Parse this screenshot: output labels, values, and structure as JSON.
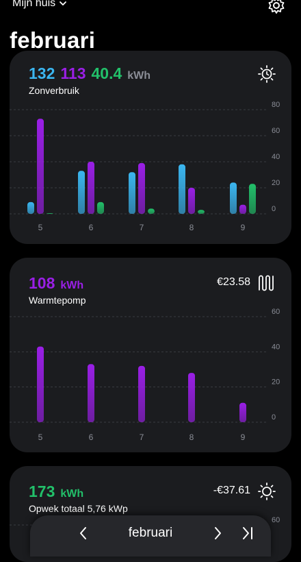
{
  "header": {
    "home_label": "Mijn huis",
    "page_title": "februari"
  },
  "colors": {
    "blue": "#3bb6f0",
    "purple": "#9a1fe6",
    "green": "#22c06a",
    "grey": "#8a8d96"
  },
  "cards": [
    {
      "title": "Zonverbruik",
      "values": [
        "132",
        "113",
        "40.4"
      ],
      "unit": "kWh",
      "icon": "sun-clock-icon",
      "chart_data": {
        "type": "bar",
        "categories": [
          "5",
          "6",
          "7",
          "8",
          "9"
        ],
        "series": [
          {
            "values": [
              9,
              33,
              32,
              38,
              24
            ],
            "color": "#3bb6f0"
          },
          {
            "values": [
              73,
              40,
              39,
              20,
              7
            ],
            "color": "#9a1fe6"
          },
          {
            "values": [
              0.5,
              9,
              4,
              3,
              23
            ],
            "color": "#22c06a"
          }
        ],
        "ylim": [
          0,
          80
        ],
        "yticks": [
          "0",
          "20",
          "40",
          "60",
          "80"
        ],
        "grid": true
      }
    },
    {
      "title": "Warmtepomp",
      "values": [
        "108"
      ],
      "unit": "kWh",
      "price": "€23.58",
      "icon": "heatpump-icon",
      "chart_data": {
        "type": "bar",
        "categories": [
          "5",
          "6",
          "7",
          "8",
          "9"
        ],
        "series": [
          {
            "values": [
              43,
              33,
              32,
              28,
              11
            ],
            "color": "#9a1fe6"
          }
        ],
        "ylim": [
          0,
          60
        ],
        "yticks": [
          "0",
          "20",
          "40",
          "60"
        ],
        "grid": true
      }
    },
    {
      "title": "Opwek totaal 5,76 kWp",
      "values": [
        "173"
      ],
      "unit": "kWh",
      "price": "-€37.61",
      "icon": "sun-icon",
      "chart_data": {
        "type": "bar",
        "categories": [],
        "series": [],
        "ylim": [
          0,
          60
        ],
        "yticks": [
          "60"
        ],
        "grid": true
      }
    }
  ],
  "nav": {
    "month": "februari"
  }
}
